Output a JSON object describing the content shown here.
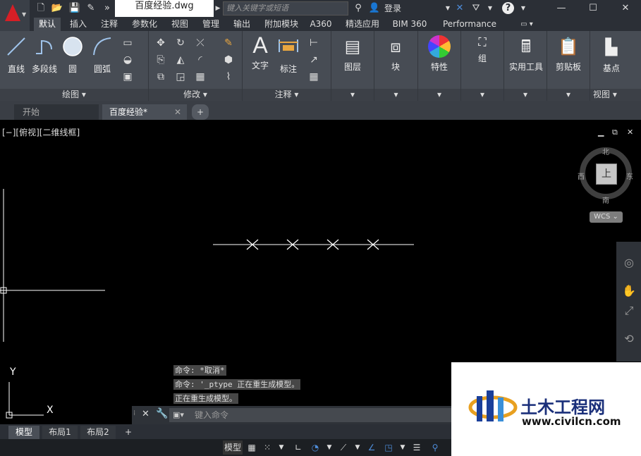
{
  "titlebar": {
    "doc_title": "百度经验.dwg",
    "search_placeholder": "键入关键字或短语",
    "login": "登录"
  },
  "ribbon_tabs": [
    "默认",
    "插入",
    "注释",
    "参数化",
    "视图",
    "管理",
    "输出",
    "附加模块",
    "A360",
    "精选应用",
    "BIM 360",
    "Performance"
  ],
  "ribbon": {
    "draw": {
      "line": "直线",
      "polyline": "多段线",
      "circle": "圆",
      "arc": "圆弧",
      "footer": "绘图 ▾"
    },
    "modify": {
      "footer": "修改 ▾"
    },
    "annotation": {
      "text": "文字",
      "dimension": "标注",
      "footer": "注释 ▾"
    },
    "layers": "图层",
    "block": "块",
    "properties": "特性",
    "groups": "组",
    "utilities": "实用工具",
    "clipboard": "剪贴板",
    "base": "基点",
    "view_footer": "视图 ▾"
  },
  "file_tabs": {
    "start": "开始",
    "current": "百度经验*",
    "add": "+"
  },
  "viewport": {
    "label": "[−][俯视][二维线框]",
    "compass": {
      "north": "北",
      "south": "南",
      "east": "东",
      "west": "西",
      "cube": "上"
    },
    "wcs": "WCS ⌄",
    "ucs_x": "X",
    "ucs_y": "Y"
  },
  "command": {
    "history": [
      "命令: *取消*",
      "命令: '_ptype 正在重生成模型。",
      "正在重生成模型。"
    ],
    "placeholder": "键入命令"
  },
  "layout_tabs": [
    "模型",
    "布局1",
    "布局2"
  ],
  "layout_add": "+",
  "status": {
    "model": "模型"
  },
  "watermark": {
    "title": "土木工程网",
    "url": "www.civilcn.com"
  }
}
